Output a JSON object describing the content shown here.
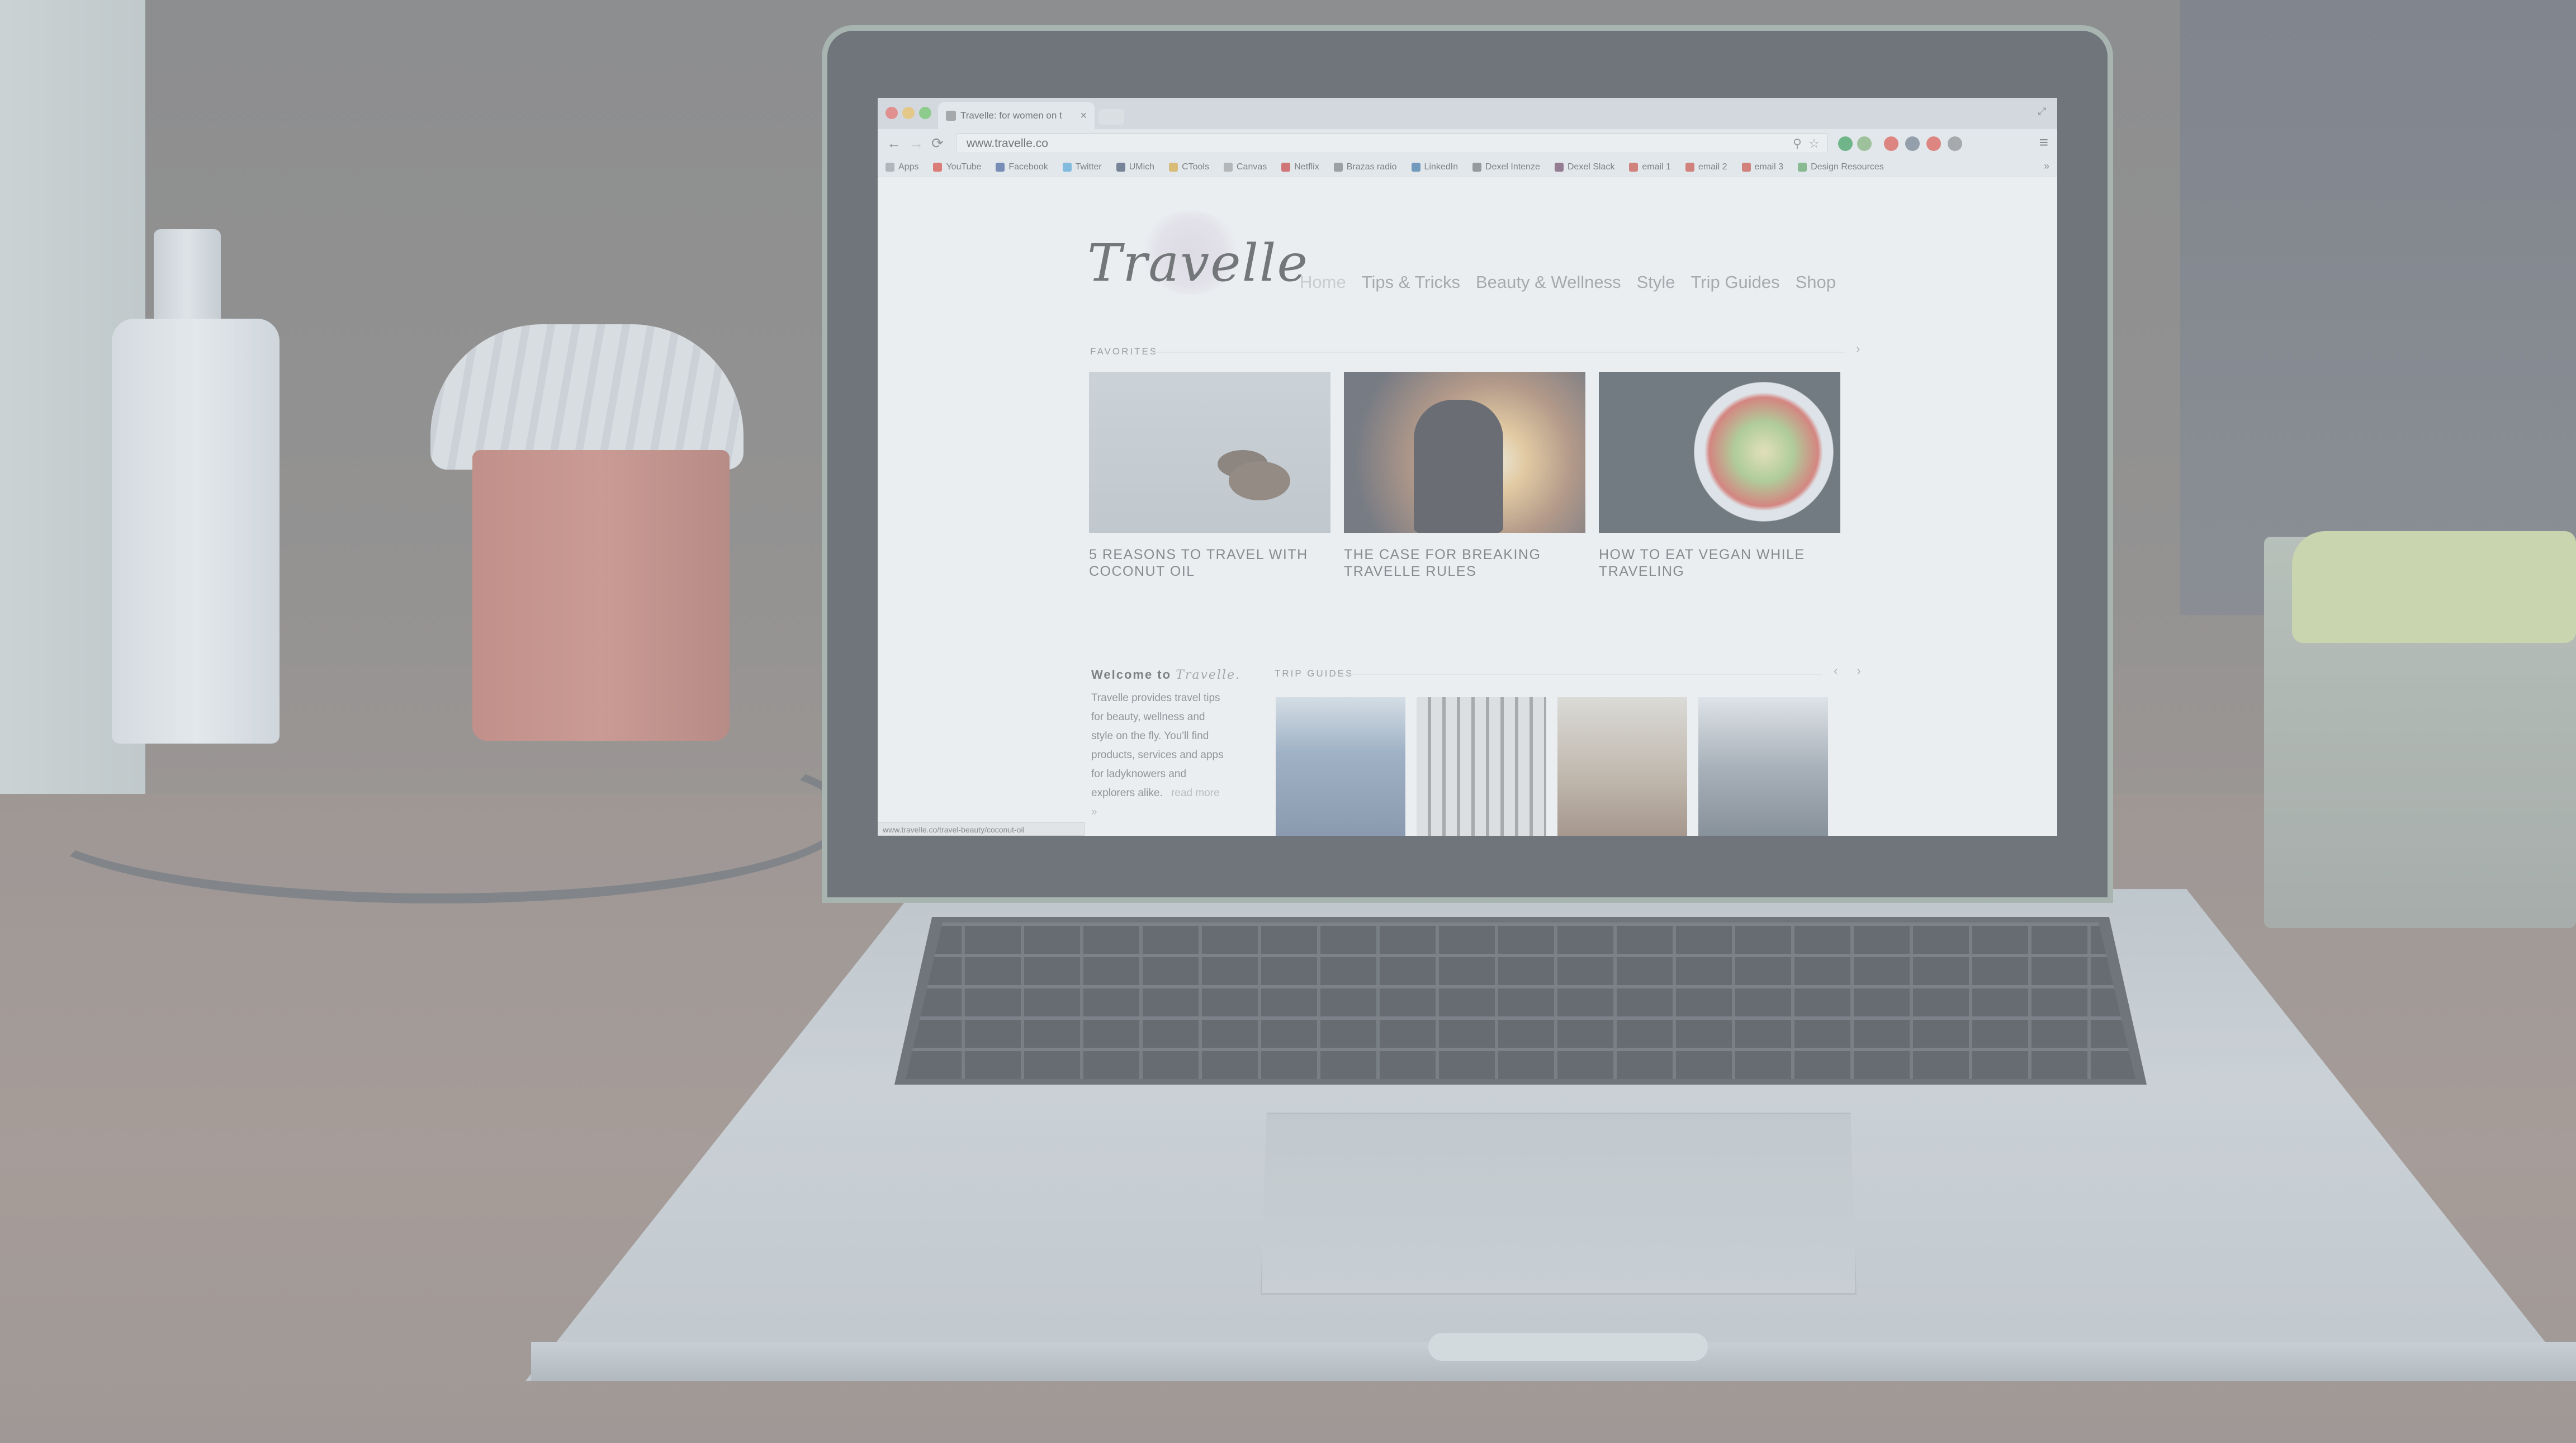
{
  "browser": {
    "tab_title": "Travelle: for women on t",
    "tab_close": "×",
    "window_controls": "⤢",
    "back_icon": "←",
    "forward_icon": "→",
    "reload_icon": "⟳",
    "url": "www.travelle.co",
    "zoom_icon": "⚲",
    "star_icon": "☆",
    "menu_icon": "≡",
    "bookmarks_overflow": "»",
    "bookmarks": [
      {
        "label": "Apps",
        "icon": "apps-icon",
        "color": "#9aa0a6"
      },
      {
        "label": "YouTube",
        "icon": "youtube-icon",
        "color": "#e33b2e"
      },
      {
        "label": "Facebook",
        "icon": "facebook-icon",
        "color": "#3b5998"
      },
      {
        "label": "Twitter",
        "icon": "twitter-icon",
        "color": "#4da7de"
      },
      {
        "label": "UMich",
        "icon": "umich-icon",
        "color": "#3b4a66"
      },
      {
        "label": "CTools",
        "icon": "ctools-icon",
        "color": "#e0a92d"
      },
      {
        "label": "Canvas",
        "icon": "canvas-icon",
        "color": "#a0a0a0"
      },
      {
        "label": "Netflix",
        "icon": "netflix-icon",
        "color": "#d32f2f"
      },
      {
        "label": "Brazas radio",
        "icon": "radio-icon",
        "color": "#7a7a7a"
      },
      {
        "label": "LinkedIn",
        "icon": "linkedin-icon",
        "color": "#2f6ea5"
      },
      {
        "label": "Dexel Intenze",
        "icon": "dexel-icon",
        "color": "#6f6f6f"
      },
      {
        "label": "Dexel Slack",
        "icon": "slack-icon",
        "color": "#6b3b5e"
      },
      {
        "label": "email 1",
        "icon": "gmail-icon",
        "color": "#d44638"
      },
      {
        "label": "email 2",
        "icon": "gmail-icon",
        "color": "#d44638"
      },
      {
        "label": "email 3",
        "icon": "gmail-icon",
        "color": "#d44638"
      },
      {
        "label": "Design Resources",
        "icon": "folder-icon",
        "color": "#58a55c"
      }
    ],
    "extension_colors": [
      "#2e9b4f",
      "#7bb36b",
      "#e84a3f",
      "#6a7785",
      "#e84a3f",
      "#8a8a8a"
    ],
    "status_url": "www.travelle.co/travel-beauty/coconut-oil"
  },
  "site": {
    "logo": "Travelle",
    "nav": [
      "Home",
      "Tips & Tricks",
      "Beauty & Wellness",
      "Style",
      "Trip Guides",
      "Shop"
    ],
    "favorites_heading": "FAVORITES",
    "carousel_arrow": "›",
    "favorites": [
      {
        "caption": "5 REASONS TO TRAVEL WITH COCONUT OIL",
        "image": "coconut-photo"
      },
      {
        "caption": "THE CASE FOR BREAKING TRAVELLE RULES",
        "image": "sunset-yoga-photo"
      },
      {
        "caption": "HOW TO EAT VEGAN WHILE TRAVELING",
        "image": "vegan-salad-photo"
      }
    ],
    "welcome": {
      "title_prefix": "Welcome to",
      "title_brand": "Travelle.",
      "body": "Travelle provides travel tips for beauty, wellness and style on the fly. You'll find products, services and apps for ladyknowers and explorers alike.",
      "more": "read more »"
    },
    "trip_guides_heading": "TRIP GUIDES",
    "trip_arrows": "‹ ›"
  }
}
